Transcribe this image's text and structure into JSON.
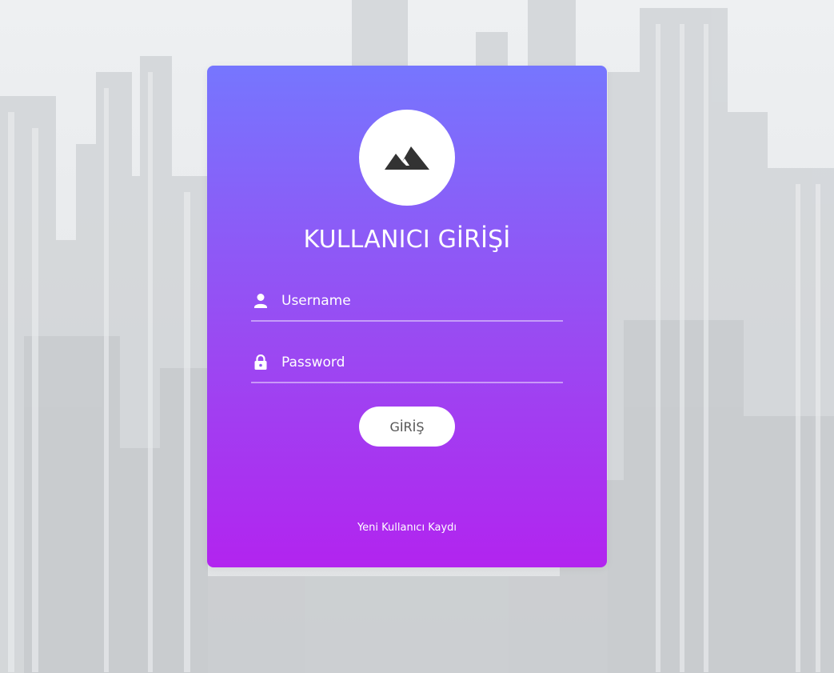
{
  "login_card": {
    "logo_icon": "mountain-icon",
    "title": "KULLANICI GİRİŞİ",
    "username": {
      "icon": "user-icon",
      "placeholder": "Username",
      "value": ""
    },
    "password": {
      "icon": "lock-icon",
      "placeholder": "Password",
      "value": ""
    },
    "submit_label": "GİRİŞ",
    "register_link": "Yeni Kullanıcı Kaydı"
  },
  "colors": {
    "card_gradient_top": "#7676fe",
    "card_gradient_bottom": "#b224ef",
    "button_bg": "#ffffff",
    "button_text": "#555555"
  }
}
